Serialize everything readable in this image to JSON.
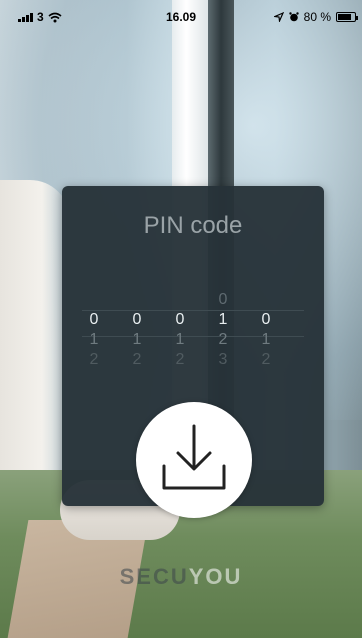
{
  "status_bar": {
    "carrier": "3",
    "time": "16.09",
    "battery_text": "80 %",
    "battery_level": 0.8
  },
  "dialog": {
    "title": "PIN code",
    "digit_columns": [
      {
        "above": "",
        "selected": "0",
        "below": [
          "1",
          "2"
        ]
      },
      {
        "above": "",
        "selected": "0",
        "below": [
          "1",
          "2"
        ]
      },
      {
        "above": "",
        "selected": "0",
        "below": [
          "1",
          "2"
        ]
      },
      {
        "above": "0",
        "selected": "1",
        "below": [
          "2",
          "3"
        ]
      },
      {
        "above": "",
        "selected": "0",
        "below": [
          "1",
          "2"
        ]
      }
    ]
  },
  "download_button": {
    "icon": "download-icon"
  },
  "brand": {
    "part_a": "SECU",
    "part_b": "YOU"
  }
}
